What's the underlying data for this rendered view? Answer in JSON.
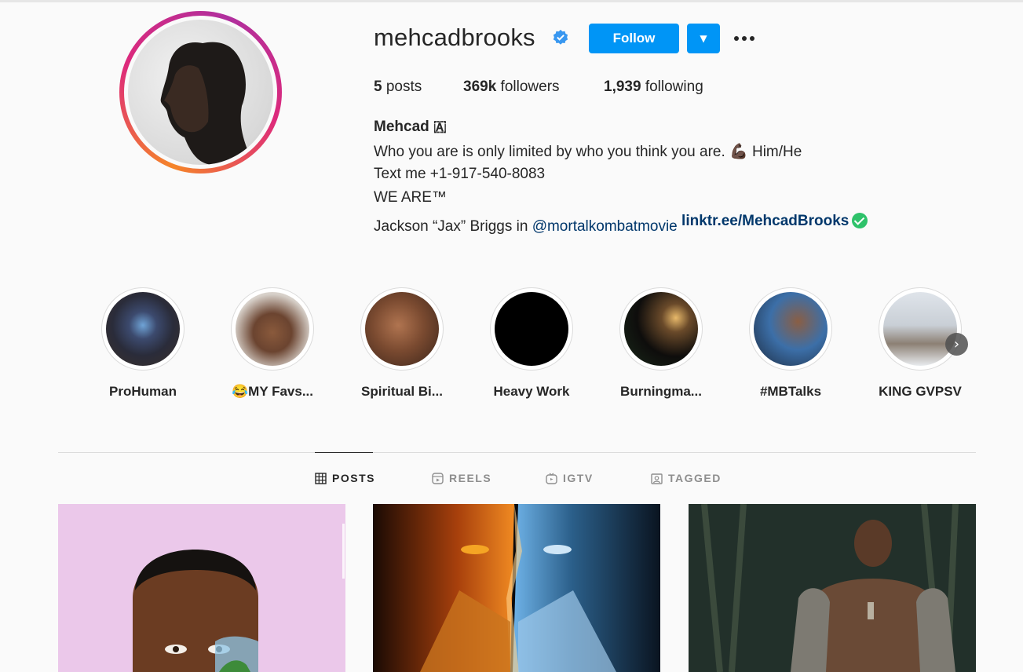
{
  "profile": {
    "username": "mehcadbrooks",
    "follow_label": "Follow",
    "dropdown_glyph": "▼",
    "posts_count": "5",
    "posts_label": " posts",
    "followers_count": "369k",
    "followers_label": " followers",
    "following_count": "1,939",
    "following_label": " following"
  },
  "bio": {
    "name": "Mehcad 🇦",
    "line1": "Who you are is only limited by who you think you are. 💪🏿 Him/He",
    "line2": "Text me +1-917-540-8083",
    "line3": "WE ARE™",
    "line4_prefix": "Jackson “Jax” Briggs in ",
    "mention": "@mortalkombatmovie",
    "link": "linktr.ee/MehcadBrooks"
  },
  "highlights": [
    {
      "label": "ProHuman"
    },
    {
      "label": "😂MY Favs..."
    },
    {
      "label": "Spiritual Bi..."
    },
    {
      "label": "Heavy Work"
    },
    {
      "label": "Burningma..."
    },
    {
      "label": "#MBTalks"
    },
    {
      "label": "KING GVPSV"
    }
  ],
  "tabs": [
    {
      "label": "POSTS",
      "icon": "grid-icon"
    },
    {
      "label": "REELS",
      "icon": "reels-icon"
    },
    {
      "label": "IGTV",
      "icon": "igtv-icon"
    },
    {
      "label": "TAGGED",
      "icon": "tagged-icon"
    }
  ],
  "colors": {
    "accent": "#0095f6",
    "link": "#00376b",
    "check": "#2ec26a"
  }
}
